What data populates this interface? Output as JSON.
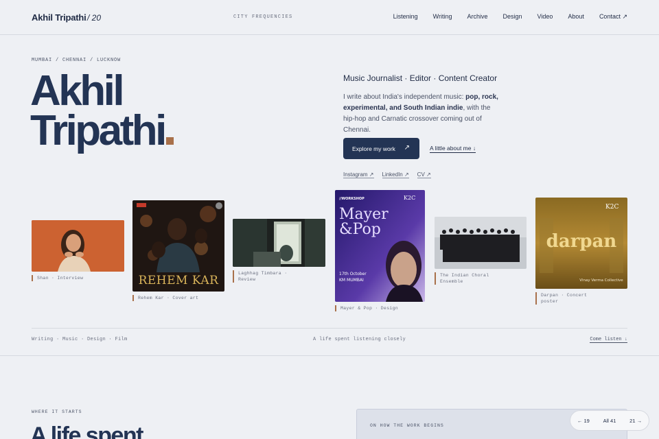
{
  "header": {
    "brand": "Akhil Tripathi",
    "brand_num": "/ 20",
    "center_label": "CITY FREQUENCIES",
    "nav": [
      "Listening",
      "Writing",
      "Archive",
      "Design",
      "Video",
      "About",
      "Contact ↗"
    ]
  },
  "hero": {
    "cities": "MUMBAI / CHENNAI / LUCKNOW",
    "name_line1": "Akhil",
    "name_line2": "Tripathi",
    "role": "Music Journalist · Editor · Content Creator",
    "bio_pre": "I write about India's independent music: ",
    "bio_bold": "pop, rock, experimental, and South Indian indie",
    "bio_post": ", with the hip-hop and Carnatic crossover coming out of Chennai.",
    "explore_label": "Explore my work",
    "explore_arrow": "↗",
    "about_link": "A little about me ↓",
    "socials": [
      "Instagram ↗",
      "LinkedIn ↗",
      "CV ↗"
    ]
  },
  "gallery": [
    {
      "caption": "Shan · Interview"
    },
    {
      "caption": "Rehem Kar · Cover art",
      "poster_title": "REHEM KAR"
    },
    {
      "caption": "Laghhag Timbara · Review"
    },
    {
      "caption": "Mayer & Pop · Design",
      "poster_tag": "//WORKSHOP",
      "poster_title_1": "Mayer",
      "poster_title_2": "&Pop",
      "poster_date": "17th October",
      "poster_venue": "KM MUMBAI",
      "poster_logo": "K2C"
    },
    {
      "caption": "The Indian Choral Ensemble"
    },
    {
      "caption": "Darpan · Concert poster",
      "poster_title": "darpan",
      "poster_logo": "K2C",
      "poster_credit": "Vinay Verma Collective"
    }
  ],
  "strip": {
    "left": "Writing · Music · Design · Film",
    "center": "A life spent listening closely",
    "right": "Come listen ↓"
  },
  "next": {
    "eyebrow": "WHERE IT STARTS",
    "heading": "A life spent",
    "panel_label": "ON HOW THE WORK BEGINS"
  },
  "pager": {
    "prev": "← 19",
    "all": "All 41",
    "next": "21 →"
  },
  "colors": {
    "navy": "#233454",
    "accent": "#a8704a",
    "background": "#eef0f4"
  }
}
